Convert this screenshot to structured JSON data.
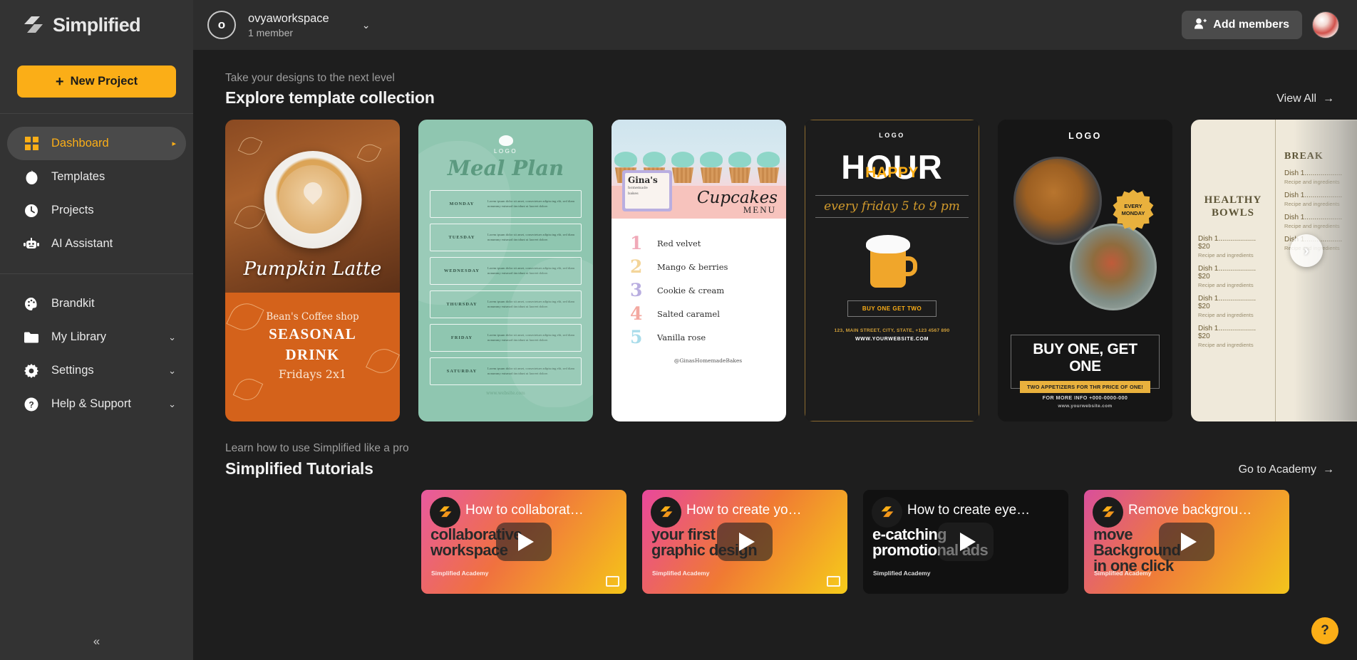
{
  "brand": {
    "name": "Simplified",
    "logo_icon": "simplified-logo-icon"
  },
  "sidebar": {
    "new_project": {
      "label": "New Project",
      "icon": "plus-icon"
    },
    "primary_items": [
      {
        "label": "Dashboard",
        "icon": "dashboard-grid-icon",
        "active": true,
        "arrow": "▸"
      },
      {
        "label": "Templates",
        "icon": "templates-icon",
        "active": false
      },
      {
        "label": "Projects",
        "icon": "clock-icon",
        "active": false
      },
      {
        "label": "AI Assistant",
        "icon": "robot-icon",
        "active": false
      }
    ],
    "secondary_items": [
      {
        "label": "Brandkit",
        "icon": "palette-icon",
        "chevron": ""
      },
      {
        "label": "My Library",
        "icon": "folder-icon",
        "chevron": "⌄"
      },
      {
        "label": "Settings",
        "icon": "gear-icon",
        "chevron": "⌄"
      },
      {
        "label": "Help & Support",
        "icon": "question-circle-icon",
        "chevron": "⌄"
      }
    ],
    "collapse_icon": "«"
  },
  "topbar": {
    "workspace_initial": "o",
    "workspace_name": "ovyaworkspace",
    "workspace_members": "1 member",
    "workspace_chevron": "⌄",
    "add_members_label": "Add members",
    "add_members_icon": "add-person-icon",
    "user_avatar": "user-avatar"
  },
  "templates_section": {
    "eyebrow": "Take your designs to the next level",
    "title": "Explore template collection",
    "link_label": "View All",
    "link_arrow": "→",
    "next_arrow": "›"
  },
  "templates": [
    {
      "name": "pumpkin-latte-template",
      "script_text": "Pumpkin Latte",
      "shop": "Bean's Coffee shop",
      "headline_line1": "SEASONAL",
      "headline_line2": "DRINK",
      "offer": "Fridays 2x1"
    },
    {
      "name": "meal-plan-template",
      "logo_label": "LOGO",
      "title": "Meal Plan",
      "lorem": "Lorem ipsum dolor sit amet, consectetuer adipiscing elit, sed diam nonummy euismod tincidunt ut laoreet dolore.",
      "days": [
        "MONDAY",
        "TUESDAY",
        "WEDNESDAY",
        "THURSDAY",
        "FRIDAY",
        "SATURDAY"
      ],
      "website": "www.website.com"
    },
    {
      "name": "cupcakes-menu-template",
      "brand_line1": "Gina's",
      "brand_line2": "homemade",
      "brand_line3": "bakes",
      "title": "Cupcakes",
      "subtitle": "MENU",
      "flavors": [
        {
          "num": "1",
          "name": "Red velvet",
          "color": "#f0a9b8"
        },
        {
          "num": "2",
          "name": "Mango & berries",
          "color": "#f3d59a"
        },
        {
          "num": "3",
          "name": "Cookie & cream",
          "color": "#b9aee0"
        },
        {
          "num": "4",
          "name": "Salted caramel",
          "color": "#f3a9a1"
        },
        {
          "num": "5",
          "name": "Vanilla rose",
          "color": "#a9dcea"
        }
      ],
      "handle": "@GinasHomemadeBakes"
    },
    {
      "name": "happy-hour-template",
      "logo_label": "LOGO",
      "big_word": "HOUR",
      "accent_word": "HAPPY",
      "schedule": "every friday 5 to 9 pm",
      "cta": "BUY ONE GET TWO",
      "address": "123, MAIN STREET, CITY, STATE, +123 4567 890",
      "website": "WWW.YOURWEBSITE.COM"
    },
    {
      "name": "buy-one-get-one-template",
      "logo_label": "LOGO",
      "badge_line1": "EVERY",
      "badge_line2": "MONDAY",
      "headline": "BUY ONE, GET ONE",
      "subline": "TWO APPETIZERS FOR THR PRICE OF ONE!",
      "info": "FOR MORE INFO +000-0000-000",
      "website": "www.yourwebsite.com"
    },
    {
      "name": "healthy-bowls-menu-template",
      "heading_right": "BREAK",
      "heading_left_line1": "HEALTHY",
      "heading_left_line2": "BOWLS",
      "dish_label": "Dish 1...................",
      "dish_price": "$20",
      "dish_desc": "Recipe and ingredients",
      "dish_count": 4
    }
  ],
  "tutorials_section": {
    "eyebrow": "Learn how to use Simplified like a pro",
    "title": "Simplified Tutorials",
    "link_label": "Go to Academy",
    "link_arrow": "→"
  },
  "tutorials": [
    {
      "name": "tutorial-collaborative-workspace",
      "title": "How to collaborat…",
      "overlay_line1": "collaborative",
      "overlay_line2": "workspace",
      "academy": "Simplified Academy",
      "theme": "tut-g1",
      "overlay_light": false
    },
    {
      "name": "tutorial-first-graphic-design",
      "title": "How to create yo…",
      "overlay_line1": "your first",
      "overlay_line2": "graphic design",
      "academy": "Simplified Academy",
      "theme": "tut-g2",
      "overlay_light": false
    },
    {
      "name": "tutorial-promotional-ads",
      "title": "How to create eye…",
      "overlay_line1": "e-catching",
      "overlay_line2": "promotional ads",
      "academy": "Simplified Academy",
      "theme": "tut-g3",
      "overlay_light": true
    },
    {
      "name": "tutorial-remove-background",
      "title": "Remove backgrou…",
      "overlay_line1": "move",
      "overlay_line2": "Background",
      "overlay_line3": "in one click",
      "academy": "Simplified Academy",
      "theme": "tut-g4",
      "overlay_light": false
    }
  ],
  "help_fab": {
    "icon": "question-mark-icon",
    "label": "?"
  },
  "colors": {
    "accent": "#FBAE17",
    "sidebar_bg": "#333333",
    "main_bg": "#1e1e1e",
    "topbar_bg": "#2d2d2d"
  }
}
